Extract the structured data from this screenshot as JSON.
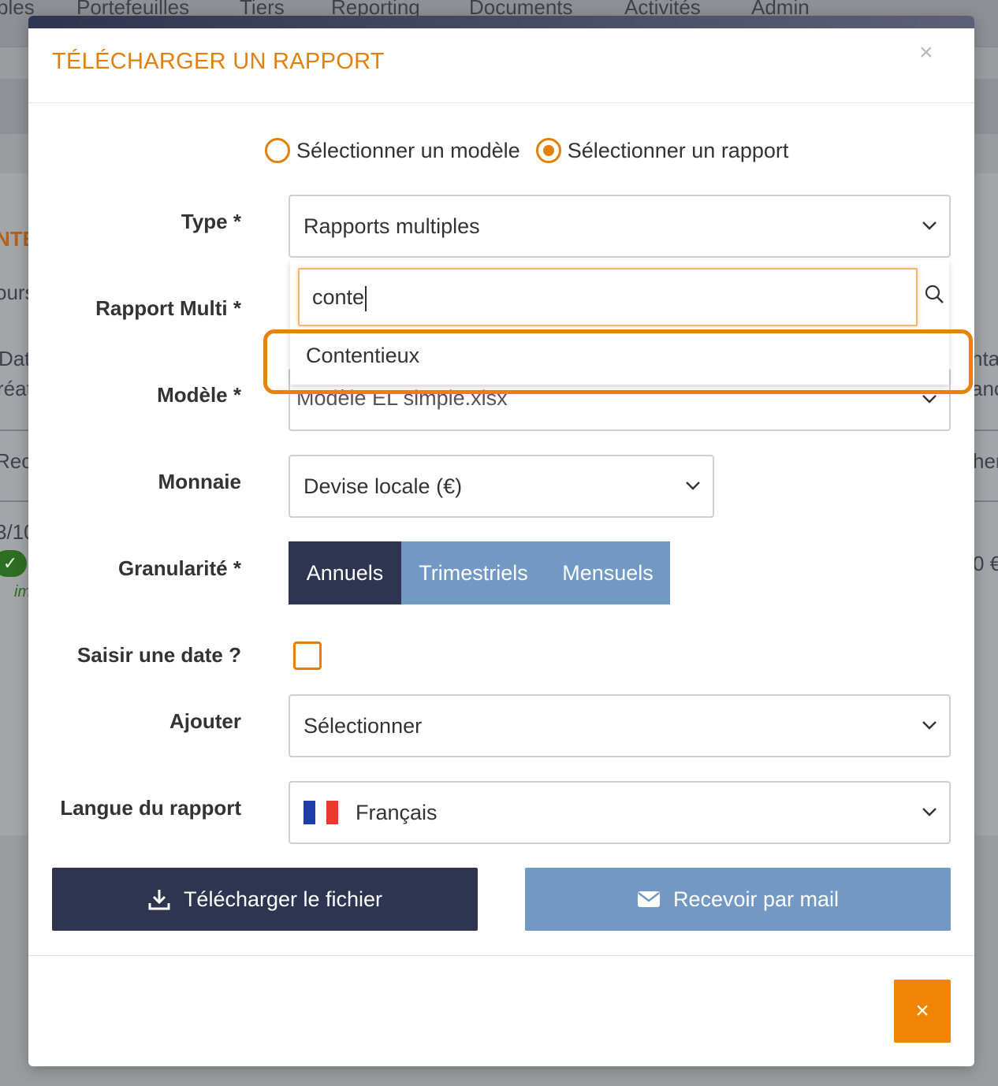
{
  "background": {
    "nav_items": [
      "bles",
      "Portefeuilles",
      "Tiers",
      "Reporting",
      "Documents",
      "Activités",
      "Admin"
    ],
    "left_fragments": [
      "NTE",
      "ours",
      "Dat",
      "réat",
      "Rech",
      "3/10"
    ],
    "right_fragments": [
      "nta",
      "anc",
      "her",
      "0 €"
    ],
    "italic_fragment": "im"
  },
  "modal": {
    "title": "TÉLÉCHARGER UN RAPPORT",
    "close_glyph": "×",
    "radio_options": [
      {
        "label": "Sélectionner un modèle",
        "checked": false
      },
      {
        "label": "Sélectionner un rapport",
        "checked": true
      }
    ],
    "fields": {
      "type": {
        "label": "Type *",
        "value": "Rapports multiples"
      },
      "rapport_multi": {
        "label": "Rapport Multi *"
      },
      "modele": {
        "label": "Modèle *",
        "value": "Modèle EL simple.xlsx"
      },
      "monnaie": {
        "label": "Monnaie",
        "value": "Devise locale (€)"
      },
      "granularite": {
        "label": "Granularité *",
        "options": [
          "Annuels",
          "Trimestriels",
          "Mensuels"
        ],
        "selected": "Annuels"
      },
      "saisir_date": {
        "label": "Saisir une date ?",
        "checked": false
      },
      "ajouter": {
        "label": "Ajouter",
        "value": "Sélectionner"
      },
      "langue": {
        "label": "Langue du rapport",
        "value": "Français"
      }
    },
    "dropdown": {
      "search_value": "conte",
      "results": [
        "Contentieux"
      ]
    },
    "buttons": {
      "download": "Télécharger le fichier",
      "mail": "Recevoir par mail",
      "cancel_glyph": "×"
    }
  },
  "colors": {
    "accent": "#e37f0c",
    "navy": "#2f3550",
    "steel_blue": "#7299c4",
    "cancel": "#ef8405"
  },
  "icons": [
    "chevron-down-icon",
    "search-icon",
    "download-icon",
    "envelope-icon",
    "close-icon",
    "france-flag-icon"
  ]
}
